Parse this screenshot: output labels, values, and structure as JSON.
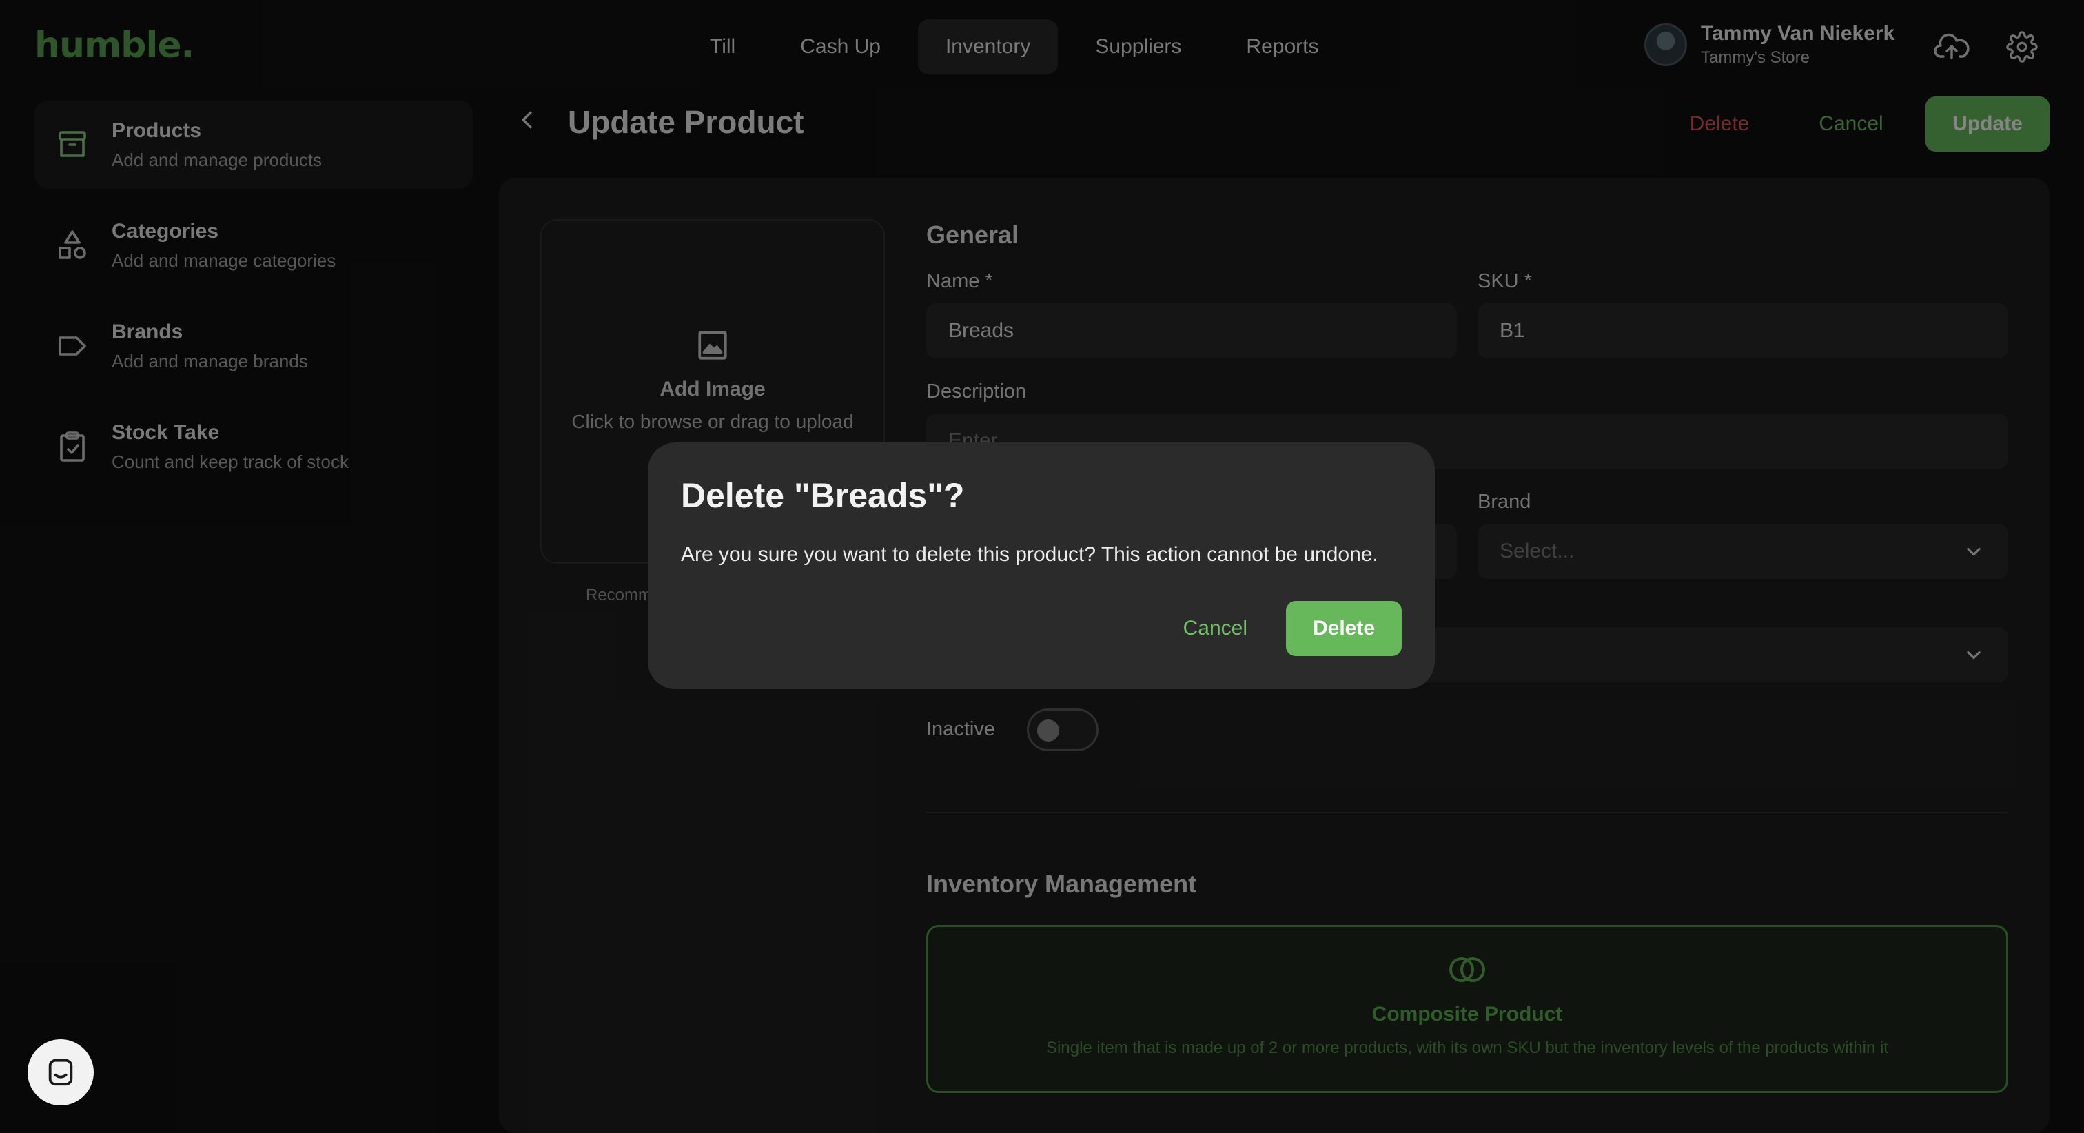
{
  "app": {
    "logo": "humble."
  },
  "nav": [
    {
      "label": "Till"
    },
    {
      "label": "Cash Up"
    },
    {
      "label": "Inventory",
      "active": true
    },
    {
      "label": "Suppliers"
    },
    {
      "label": "Reports"
    }
  ],
  "user": {
    "name": "Tammy Van Niekerk",
    "store": "Tammy's Store"
  },
  "sidebar": {
    "items": [
      {
        "title": "Products",
        "subtitle": "Add and manage products",
        "icon": "archive-box-icon",
        "active": true
      },
      {
        "title": "Categories",
        "subtitle": "Add and manage categories",
        "icon": "shapes-icon"
      },
      {
        "title": "Brands",
        "subtitle": "Add and manage brands",
        "icon": "tag-icon"
      },
      {
        "title": "Stock Take",
        "subtitle": "Count and keep track of stock",
        "icon": "clipboard-check-icon"
      }
    ]
  },
  "header": {
    "title": "Update Product",
    "delete_label": "Delete",
    "cancel_label": "Cancel",
    "update_label": "Update"
  },
  "image_upload": {
    "title": "Add Image",
    "subtitle": "Click to browse or drag to upload",
    "recommendation": "Recomm"
  },
  "general": {
    "title": "General",
    "name_label": "Name *",
    "name_value": "Breads",
    "sku_label": "SKU *",
    "sku_value": "B1",
    "description_label": "Description",
    "description_placeholder": "Enter",
    "brand_label": "Brand",
    "brand_placeholder": "Select...",
    "inactive_label": "Inactive"
  },
  "inventory": {
    "title": "Inventory Management",
    "composite_title": "Composite Product",
    "composite_desc": "Single item that is made up of 2 or more products, with its own SKU but the inventory levels of the products within it"
  },
  "modal": {
    "title": "Delete \"Breads\"?",
    "message": "Are you sure you want to delete this product? This action cannot be undone.",
    "cancel_label": "Cancel",
    "delete_label": "Delete"
  },
  "colors": {
    "accent": "#66b85a",
    "danger": "#e05454",
    "background": "#111111"
  }
}
